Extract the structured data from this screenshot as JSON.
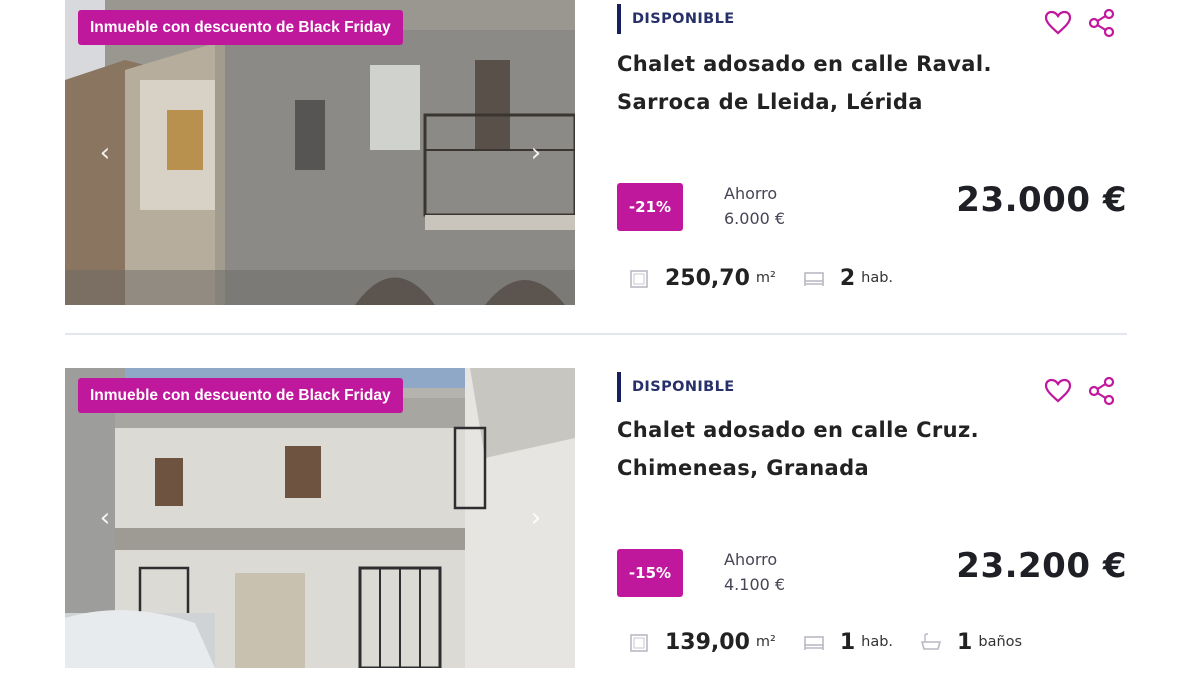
{
  "listings": [
    {
      "promo": "Inmueble con descuento de Black Friday",
      "status": "DISPONIBLE",
      "title_line1": "Chalet adosado en calle Raval.",
      "title_line2": "Sarroca de Lleida, Lérida",
      "discount": "-21%",
      "savings_label": "Ahorro",
      "savings_value": "6.000 €",
      "price": "23.000 €",
      "area": "250,70",
      "area_unit": "m²",
      "rooms": "2",
      "rooms_unit": "hab."
    },
    {
      "promo": "Inmueble con descuento de Black Friday",
      "status": "DISPONIBLE",
      "title_line1": "Chalet adosado en calle Cruz.",
      "title_line2": "Chimeneas, Granada",
      "discount": "-15%",
      "savings_label": "Ahorro",
      "savings_value": "4.100 €",
      "price": "23.200 €",
      "area": "139,00",
      "area_unit": "m²",
      "rooms": "1",
      "rooms_unit": "hab.",
      "baths": "1",
      "baths_unit": "baños"
    }
  ],
  "icons": {
    "favorite": "heart-icon",
    "share": "share-icon",
    "area": "area-icon",
    "rooms": "bed-icon",
    "baths": "bathtub-icon",
    "prev": "chevron-left-icon",
    "next": "chevron-right-icon"
  },
  "colors": {
    "accent": "#c0189d",
    "status_bar": "#17205a",
    "text": "#222222"
  }
}
